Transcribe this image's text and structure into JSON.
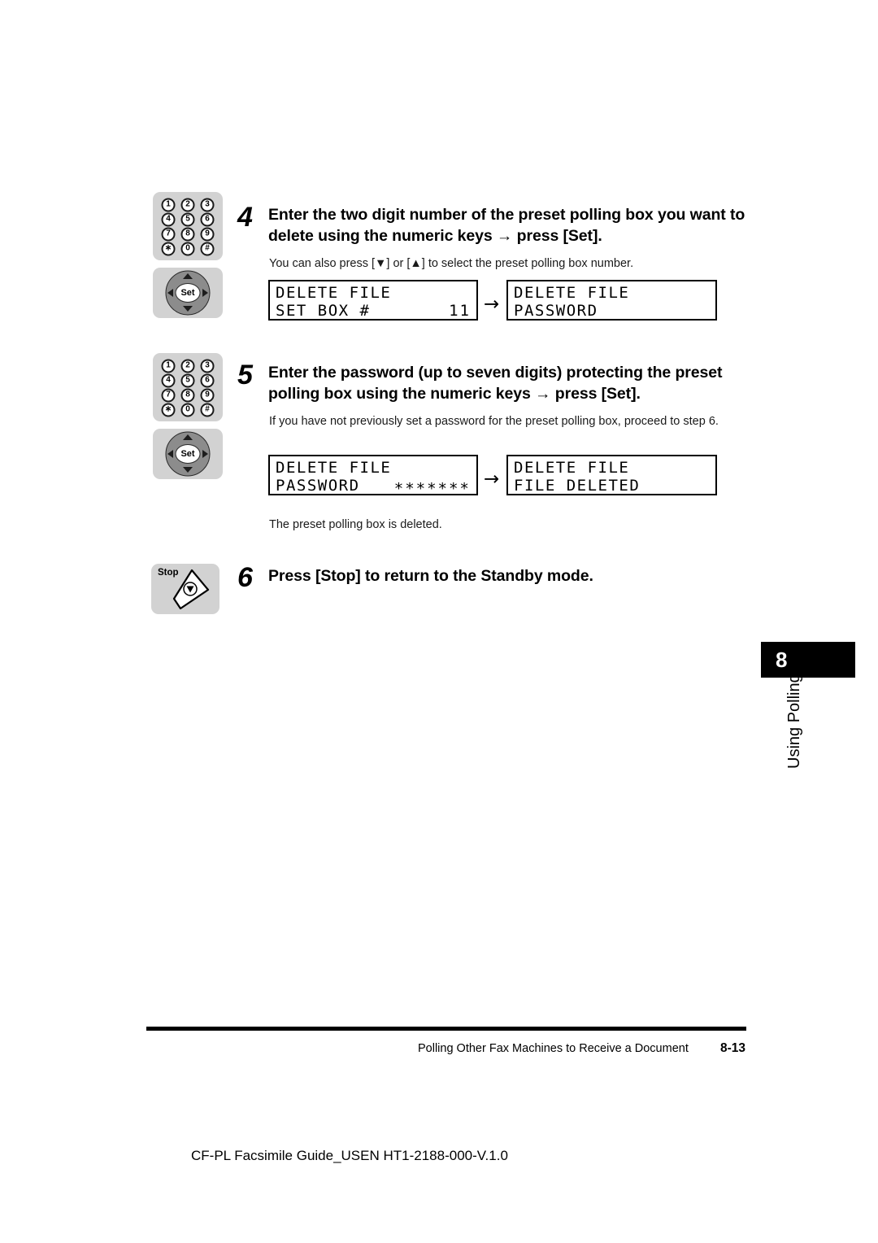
{
  "document": {
    "caption": "CF-PL Facsimile Guide_USEN HT1-2188-000-V.1.0",
    "footer_section": "Polling Other Fax Machines to Receive a Document",
    "footer_page": "8-13",
    "chapter_number": "8",
    "chapter_label": "Using Polling",
    "accent_color": "#000000",
    "key_bg_color": "#d2d2d2"
  },
  "icons": {
    "keypad_keys": [
      "1",
      "2",
      "3",
      "4",
      "5",
      "6",
      "7",
      "8",
      "9",
      "∗",
      "0",
      "#"
    ],
    "set_label": "Set",
    "stop_label": "Stop",
    "arrow_glyph": "→"
  },
  "steps": [
    {
      "number": "4",
      "title": "Enter the two digit number of the preset polling box you want to delete using the numeric keys → press [Set].",
      "note": "You can also press [▼] or [▲] to select the preset polling box number.",
      "lcd_before": {
        "line1_left": "DELETE FILE",
        "line1_right": "",
        "line2_left": "SET BOX #",
        "line2_right": "11"
      },
      "lcd_after": {
        "line1_left": "DELETE FILE",
        "line1_right": "",
        "line2_left": "PASSWORD",
        "line2_right": ""
      },
      "caption": ""
    },
    {
      "number": "5",
      "title": "Enter the password (up to seven digits) protecting the preset polling box using the numeric keys → press [Set].",
      "note": "If you have not previously set a password for the preset polling box, proceed to step 6.",
      "lcd_before": {
        "line1_left": "DELETE FILE",
        "line1_right": "",
        "line2_left": "PASSWORD",
        "line2_right": "∗∗∗∗∗∗∗"
      },
      "lcd_after": {
        "line1_left": "DELETE FILE",
        "line1_right": "",
        "line2_left": "FILE DELETED",
        "line2_right": ""
      },
      "caption": "The preset polling box is deleted."
    },
    {
      "number": "6",
      "title": "Press [Stop] to return to the Standby mode.",
      "note": "",
      "caption": ""
    }
  ]
}
